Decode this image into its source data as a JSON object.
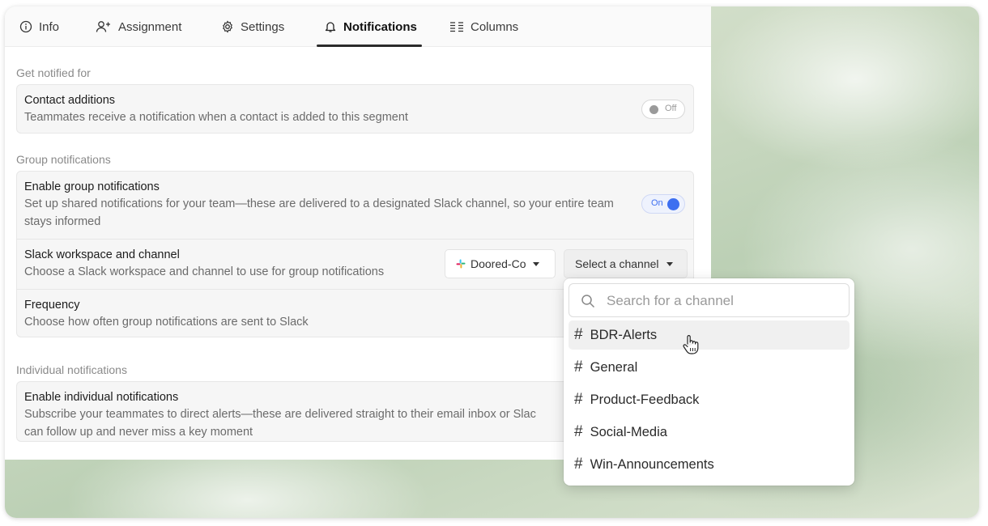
{
  "tabs": [
    {
      "label": "Info",
      "icon": "info-icon"
    },
    {
      "label": "Assignment",
      "icon": "user-plus-icon"
    },
    {
      "label": "Settings",
      "icon": "gear-icon"
    },
    {
      "label": "Notifications",
      "icon": "bell-icon",
      "active": true
    },
    {
      "label": "Columns",
      "icon": "columns-icon"
    }
  ],
  "sections": {
    "notified_for": "Get notified for",
    "group": "Group notifications",
    "individual": "Individual notifications"
  },
  "contact_additions": {
    "title": "Contact additions",
    "desc": "Teammates receive a notification when a contact is added to this segment",
    "toggle": "Off"
  },
  "group_notifications": {
    "title": "Enable group notifications",
    "desc": "Set up shared notifications for your team—these are delivered to a designated Slack channel, so your entire team stays informed",
    "toggle": "On"
  },
  "slack": {
    "title": "Slack workspace and channel",
    "desc": "Choose a Slack workspace and channel to use for group notifications",
    "workspace": "Doored-Co",
    "channel_placeholder": "Select a channel"
  },
  "frequency": {
    "title": "Frequency",
    "desc": "Choose how often group notifications are sent to Slack"
  },
  "individual_notifications": {
    "title": "Enable individual notifications",
    "desc_line1": "Subscribe your teammates to direct alerts—these are delivered straight to their email inbox or Slac",
    "desc_line2": "can follow up and never miss a key moment"
  },
  "channel_dropdown": {
    "search_placeholder": "Search for a channel",
    "options": [
      "BDR-Alerts",
      "General",
      "Product-Feedback",
      "Social-Media",
      "Win-Announcements"
    ],
    "hovered": "BDR-Alerts"
  },
  "colors": {
    "accent": "#3d6ff0",
    "slack_brand": "#e01e5a"
  }
}
